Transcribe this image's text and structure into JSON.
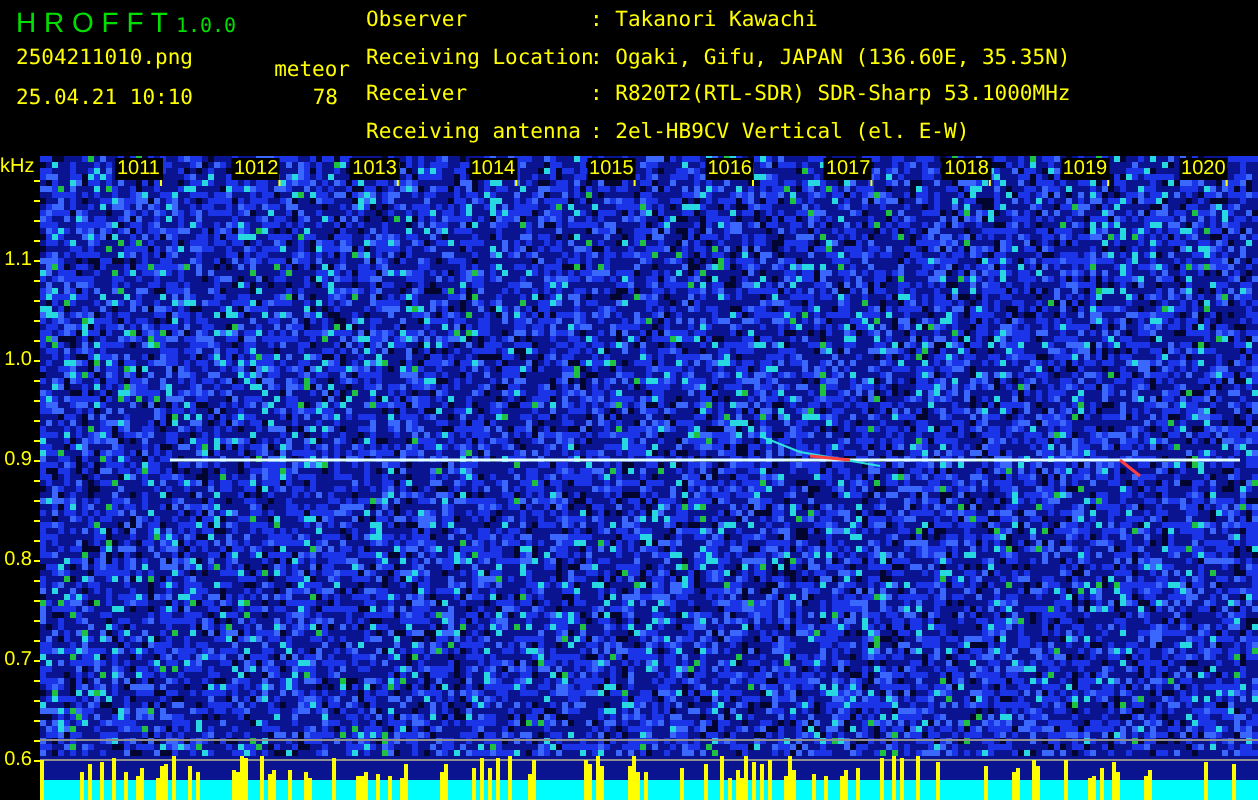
{
  "header": {
    "app_name": "H R O F F T",
    "version": "1.0.0",
    "filename": "2504211010.png",
    "datetime": "25.04.21 10:10",
    "count_label": "meteor",
    "count": "78"
  },
  "info": [
    {
      "label": "Observer",
      "value": ": Takanori Kawachi"
    },
    {
      "label": "Receiving Location",
      "value": ": Ogaki, Gifu, JAPAN (136.60E, 35.35N)"
    },
    {
      "label": "Receiver",
      "value": ": R820T2(RTL-SDR) SDR-Sharp 53.1000MHz"
    },
    {
      "label": "Receiving antenna",
      "value": ": 2el-HB9CV Vertical (el. E-W)"
    }
  ],
  "spectrogram": {
    "unit": "kHz",
    "time_labels": [
      "1011",
      "1012",
      "1013",
      "1014",
      "1015",
      "1016",
      "1017",
      "1018",
      "1019",
      "1020"
    ],
    "freq_labels": [
      "1.1",
      "1.0",
      "0.9",
      "0.8",
      "0.7",
      "0.6"
    ]
  }
}
